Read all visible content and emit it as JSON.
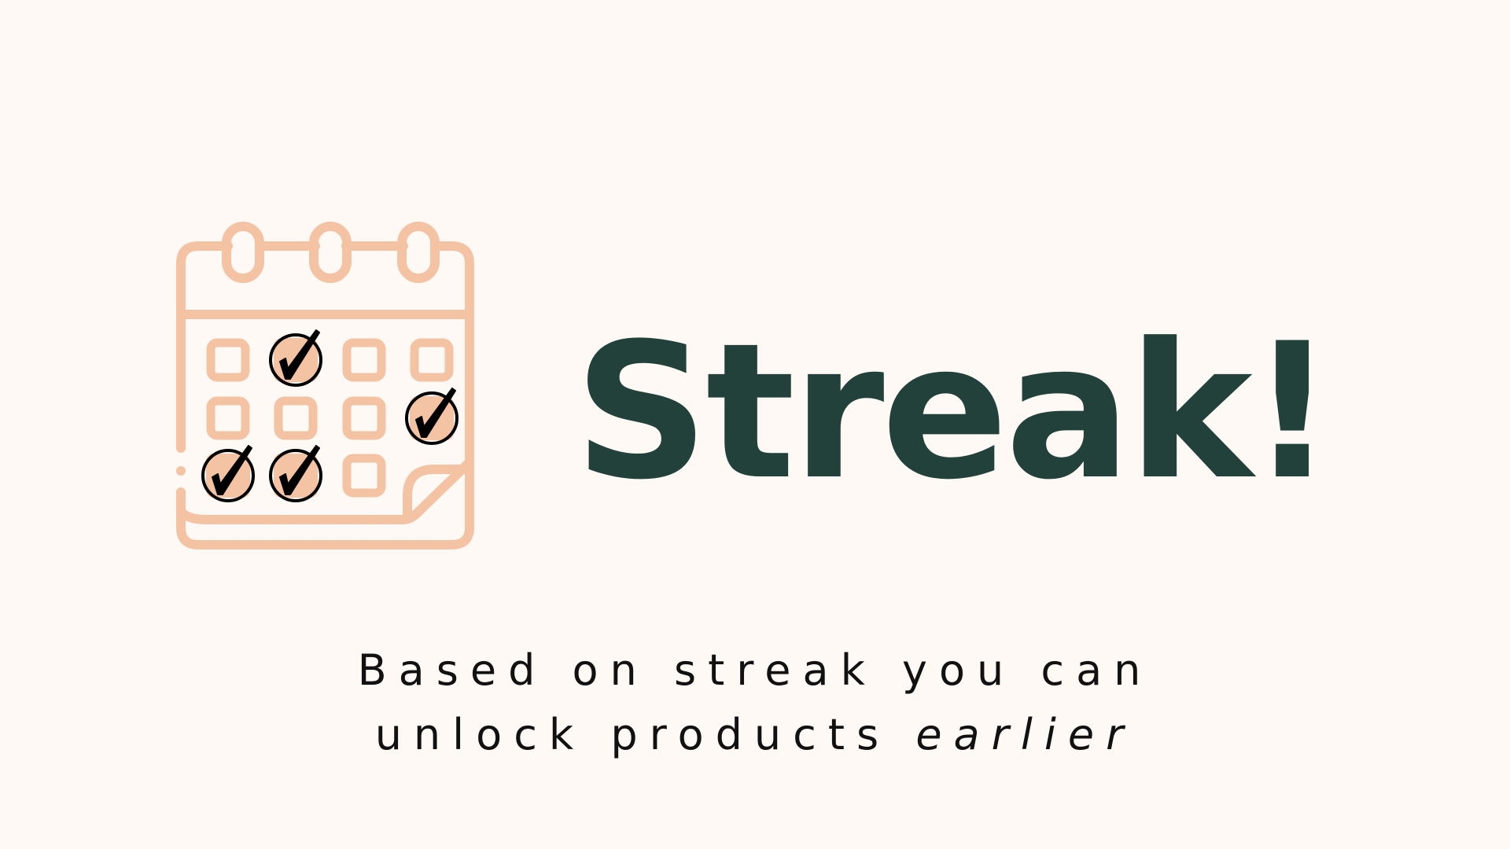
{
  "slide": {
    "title": "Streak!",
    "subtitle_line1": "Based on streak you can",
    "subtitle_line2_plain": "unlock products",
    "subtitle_line2_emphasis": "earlier"
  },
  "icons": {
    "calendar": "calendar-checked-icon"
  },
  "calendar_marks": {
    "rows": [
      [
        false,
        true,
        false,
        false
      ],
      [
        false,
        false,
        false,
        true
      ],
      [
        true,
        true,
        false
      ]
    ]
  },
  "colors": {
    "background": "#FFF9F5",
    "title": "#21413A",
    "subtitle": "#111111",
    "calendar_line": "#F4C3A3",
    "check": "#000000"
  }
}
